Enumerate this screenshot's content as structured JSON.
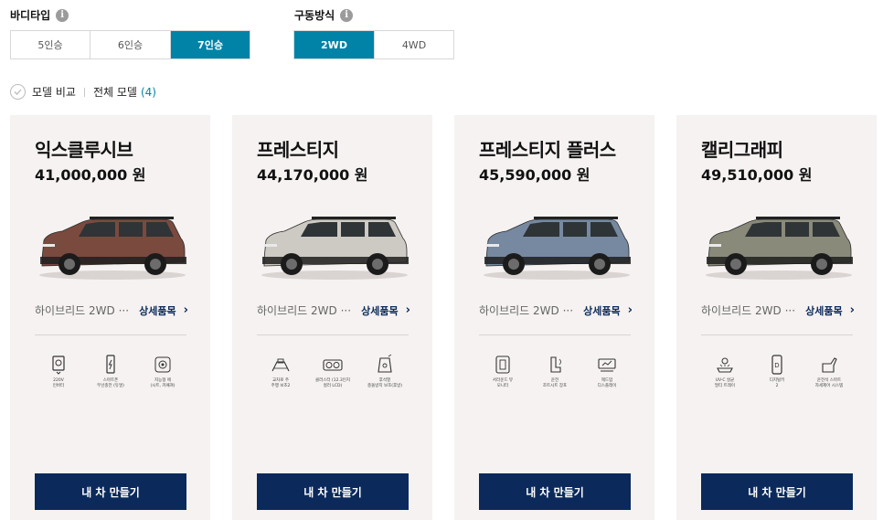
{
  "filters": {
    "body_type": {
      "label": "바디타입",
      "options": [
        "5인승",
        "6인승",
        "7인승"
      ],
      "selected": "7인승"
    },
    "drive": {
      "label": "구동방식",
      "options": [
        "2WD",
        "4WD"
      ],
      "selected": "2WD"
    }
  },
  "compare": {
    "label": "모델 비교",
    "all_models_label": "전체 모델",
    "count": "(4)"
  },
  "cards": [
    {
      "name": "익스클루시브",
      "price": "41,000,000 원",
      "trim": "하이브리드 2WD ···",
      "detail_label": "상세품목",
      "car_color": "#7a4a3e",
      "features": [
        {
          "icon": "outlet-icon",
          "text": "220V\n인버터"
        },
        {
          "icon": "phone-charging-icon",
          "text": "스마트폰\n무선충전 (듀얼)"
        },
        {
          "icon": "seat-heating-icon",
          "text": "지능형 에\n(시트, 카패쳐)"
        }
      ],
      "cta": "내 차 만들기"
    },
    {
      "name": "프레스티지",
      "price": "44,170,000 원",
      "trim": "하이브리드 2WD ···",
      "detail_label": "상세품목",
      "car_color": "#cdcac3",
      "features": [
        {
          "icon": "collision-assist-icon",
          "text": "교차로 주\n주행 보조2"
        },
        {
          "icon": "cluster-display-icon",
          "text": "클러스터 (12.3인치\n컬러 LCD)"
        },
        {
          "icon": "rear-seat-alert-icon",
          "text": "후석열\n충돌방지 보조(후방)"
        }
      ],
      "cta": "내 차 만들기"
    },
    {
      "name": "프레스티지 플러스",
      "price": "45,590,000 원",
      "trim": "하이브리드 2WD ···",
      "detail_label": "상세품목",
      "car_color": "#7689a0",
      "features": [
        {
          "icon": "camera-view-icon",
          "text": "서라운드 뷰\n모니터"
        },
        {
          "icon": "driver-seat-icon",
          "text": "운전\n조트시트 장포"
        },
        {
          "icon": "hud-display-icon",
          "text": "헤드업\n디스플레이"
        }
      ],
      "cta": "내 차 만들기"
    },
    {
      "name": "캘리그래피",
      "price": "49,510,000 원",
      "trim": "하이브리드 2WD ···",
      "detail_label": "상세품목",
      "car_color": "#8a8a7a",
      "features": [
        {
          "icon": "uvc-lamp-icon",
          "text": "UV-C 살균\n멀티 트레이"
        },
        {
          "icon": "digital-key-icon",
          "text": "디지털키\n2"
        },
        {
          "icon": "ergo-seat-icon",
          "text": "운전석 스마트\n자세제어 시스템"
        }
      ],
      "cta": "내 차 만들기"
    }
  ],
  "colors": {
    "accent": "#0083a7",
    "navy": "#0b2a5b",
    "card_bg": "#f5f2f1"
  }
}
